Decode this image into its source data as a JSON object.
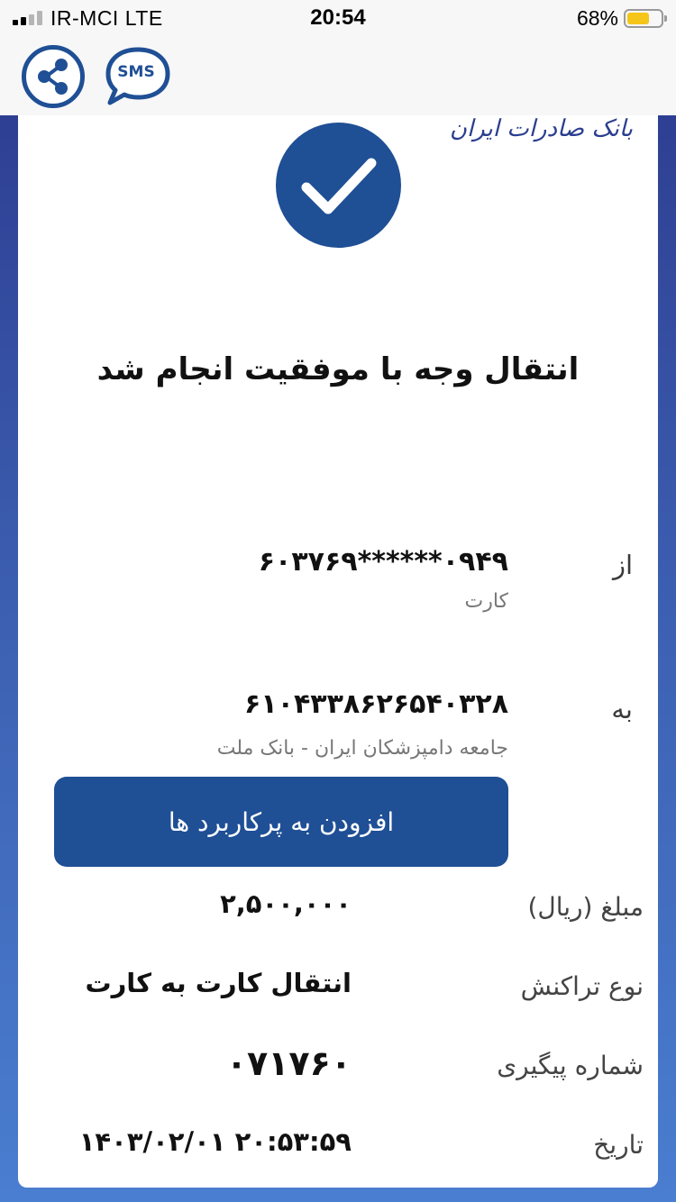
{
  "status_bar": {
    "carrier": "IR-MCI  LTE",
    "time": "20:54",
    "battery_percent_text": "68%",
    "battery_level": 0.68,
    "signal_bars_active": 2,
    "signal_bars_total": 4
  },
  "actions": {
    "share_icon": "share-icon",
    "sms_label": "SMS"
  },
  "logo_text": "بانک صادرات ایران",
  "headline": "انتقال وجه با موفقیت انجام شد",
  "from": {
    "label": "از",
    "value": "۶۰۳۷۶۹******۰۹۴۹",
    "sub": "کارت"
  },
  "to": {
    "label": "به",
    "value": "۶۱۰۴۳۳۸۶۲۶۵۴۰۳۲۸",
    "sub": "جامعه  دامپزشکان  ایران     -  بانک ملت"
  },
  "add_button": "افزودن به پرکاربرد ها",
  "amount": {
    "label": "مبلغ (ریال)",
    "value": "۲,۵۰۰,۰۰۰"
  },
  "type": {
    "label": "نوع تراکنش",
    "value": "انتقال کارت به کارت"
  },
  "tracking": {
    "label": "شماره پیگیری",
    "value": "۰۷۱۷۶۰"
  },
  "date": {
    "label": "تاریخ",
    "value": "۱۴۰۳/۰۲/۰۱   ۲۰:۵۳:۵۹"
  },
  "colors": {
    "primary": "#1f4f95",
    "battery": "#f5c518",
    "frame_top": "#2e3f93",
    "frame_bottom": "#4a7ed0"
  }
}
